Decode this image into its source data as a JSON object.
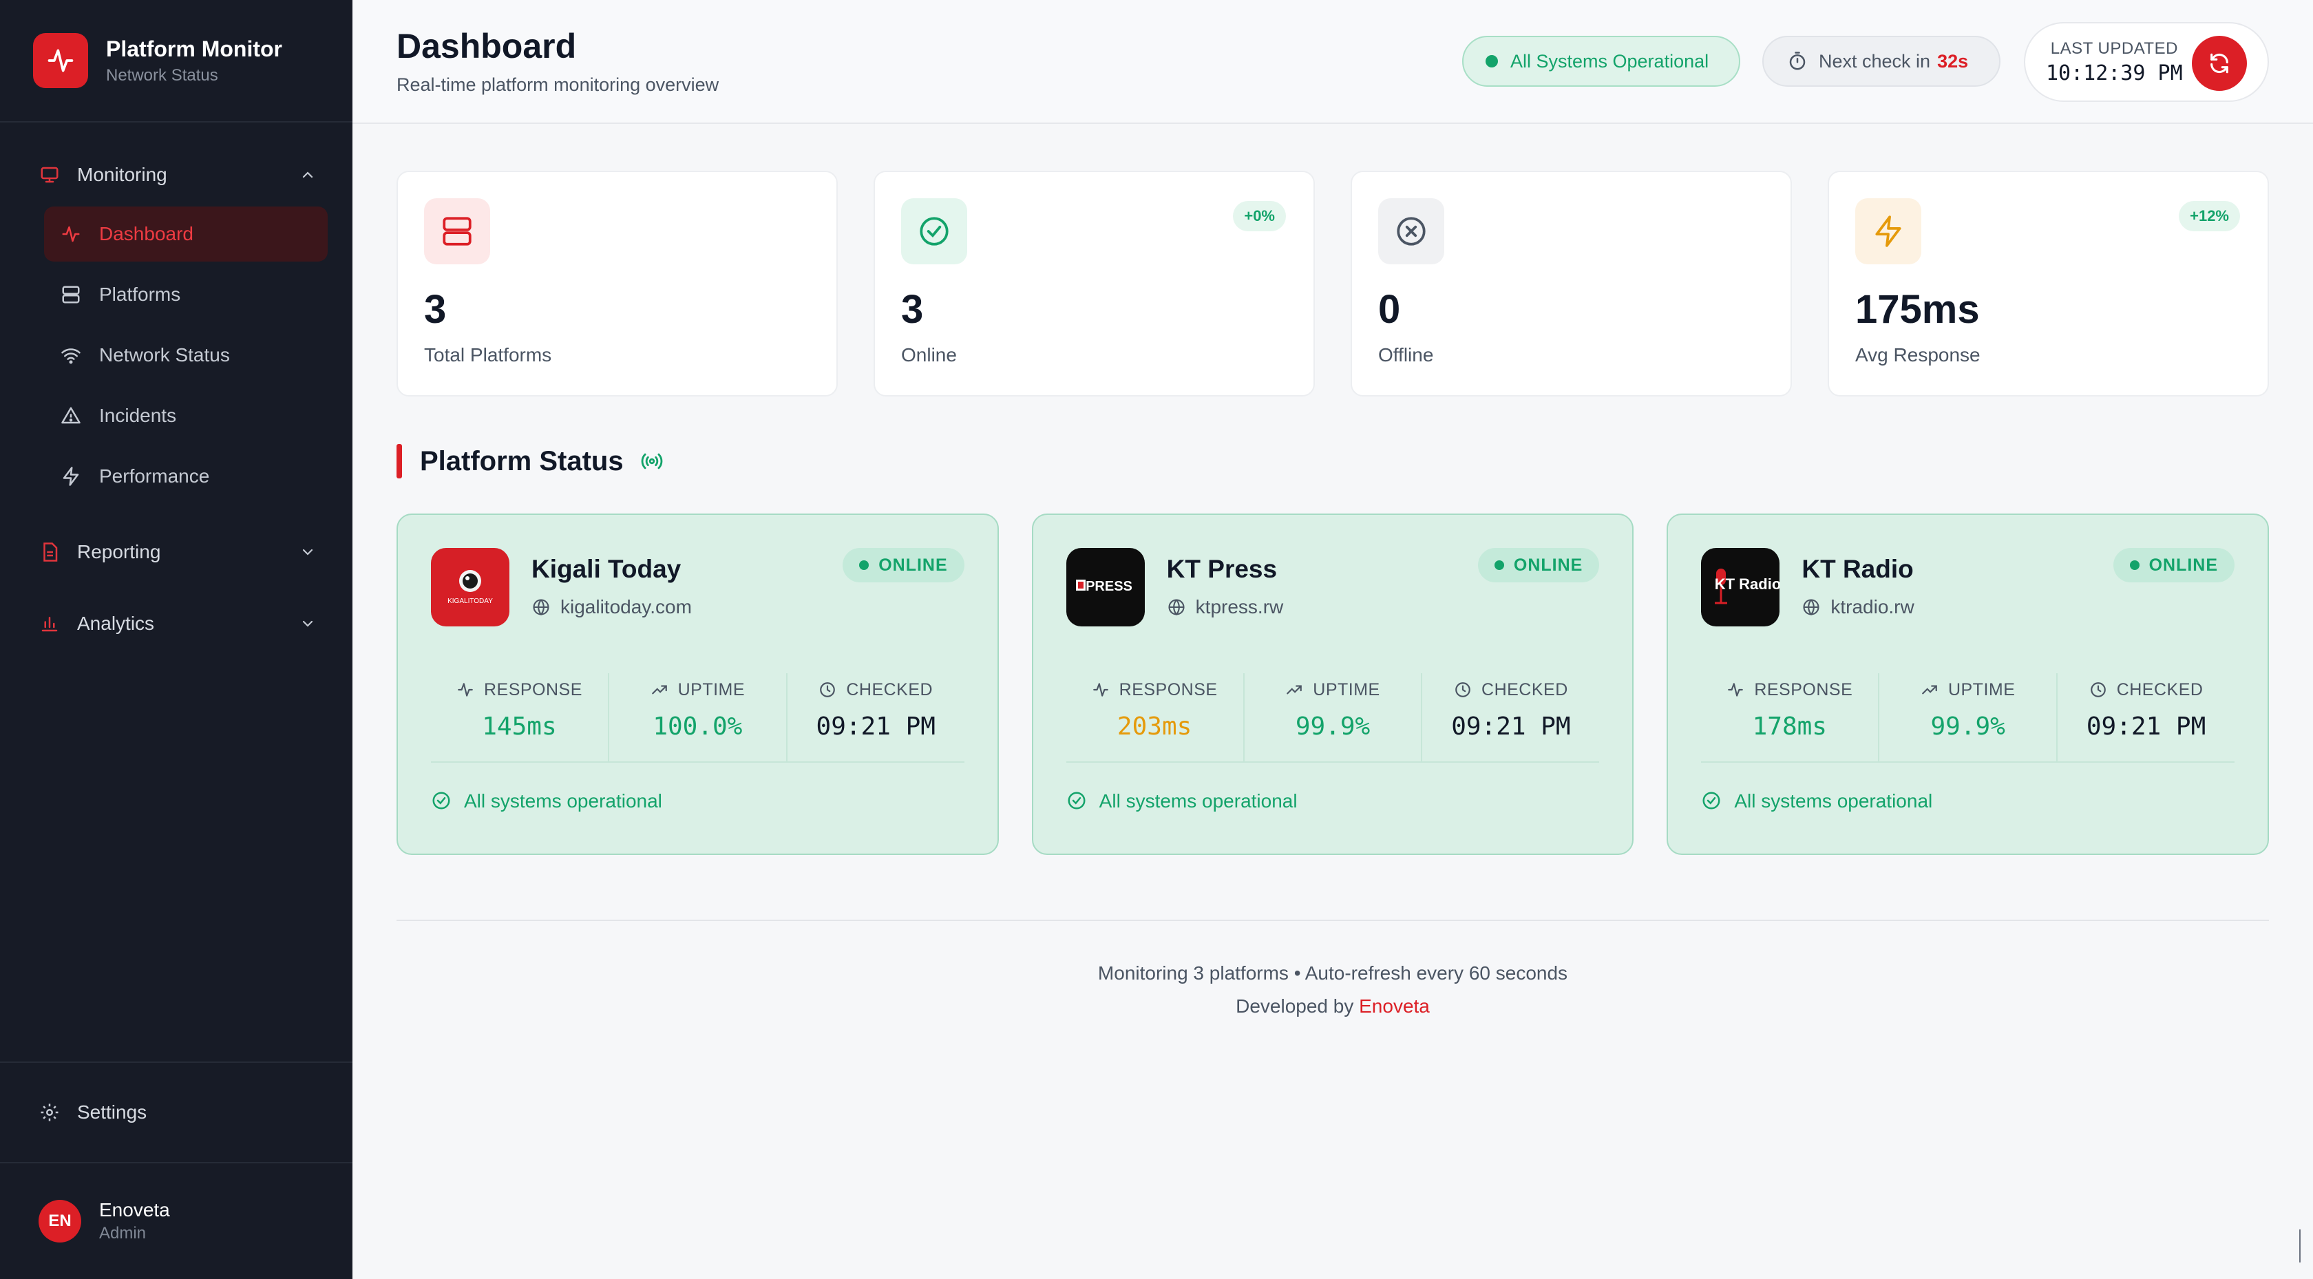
{
  "brand": {
    "title": "Platform Monitor",
    "subtitle": "Network Status"
  },
  "sidebar": {
    "groups": [
      {
        "label": "Monitoring",
        "icon": "monitor-icon",
        "expanded": true
      },
      {
        "label": "Reporting",
        "icon": "file-report-icon",
        "expanded": false
      },
      {
        "label": "Analytics",
        "icon": "bar-chart-icon",
        "expanded": false
      }
    ],
    "items": [
      {
        "label": "Dashboard",
        "icon": "activity-icon",
        "active": true
      },
      {
        "label": "Platforms",
        "icon": "server-icon"
      },
      {
        "label": "Network Status",
        "icon": "wifi-icon"
      },
      {
        "label": "Incidents",
        "icon": "alert-triangle-icon"
      },
      {
        "label": "Performance",
        "icon": "zap-icon"
      }
    ],
    "settings_label": "Settings",
    "user": {
      "initials": "EN",
      "name": "Enoveta",
      "role": "Admin"
    }
  },
  "header": {
    "title": "Dashboard",
    "subtitle": "Real-time platform monitoring overview",
    "status_text": "All Systems Operational",
    "next_check_label": "Next check in",
    "next_check_value": "32s",
    "last_updated_label": "LAST UPDATED",
    "last_updated_time": "10:12:39 PM"
  },
  "stats": [
    {
      "value": "3",
      "label": "Total Platforms",
      "badge": "",
      "icon": "server-icon"
    },
    {
      "value": "3",
      "label": "Online",
      "badge": "+0%",
      "icon": "check-circle-icon"
    },
    {
      "value": "0",
      "label": "Offline",
      "badge": "",
      "icon": "x-circle-icon"
    },
    {
      "value": "175ms",
      "label": "Avg Response",
      "badge": "+12%",
      "icon": "zap-icon"
    }
  ],
  "section": {
    "title": "Platform Status"
  },
  "platforms": [
    {
      "name": "Kigali Today",
      "url": "kigalitoday.com",
      "status": "ONLINE",
      "logo_text": "KIGALITODAY",
      "response_label": "RESPONSE",
      "response": "145ms",
      "uptime_label": "UPTIME",
      "uptime": "100.0%",
      "checked_label": "CHECKED",
      "checked": "09:21 PM",
      "footer": "All systems operational"
    },
    {
      "name": "KT Press",
      "url": "ktpress.rw",
      "status": "ONLINE",
      "logo_text": "PRESS",
      "response_label": "RESPONSE",
      "response": "203ms",
      "uptime_label": "UPTIME",
      "uptime": "99.9%",
      "checked_label": "CHECKED",
      "checked": "09:21 PM",
      "footer": "All systems operational"
    },
    {
      "name": "KT Radio",
      "url": "ktradio.rw",
      "status": "ONLINE",
      "logo_text": "KT Radio",
      "response_label": "RESPONSE",
      "response": "178ms",
      "uptime_label": "UPTIME",
      "uptime": "99.9%",
      "checked_label": "CHECKED",
      "checked": "09:21 PM",
      "footer": "All systems operational"
    }
  ],
  "footer": {
    "line1": "Monitoring 3 platforms • Auto-refresh every 60 seconds",
    "developed_by": "Developed by",
    "developer": "Enoveta"
  },
  "colors": {
    "brand_red": "#dc1f26",
    "success_green": "#13a36a",
    "warning_amber": "#e59a0b",
    "sidebar_bg": "#171b26"
  }
}
